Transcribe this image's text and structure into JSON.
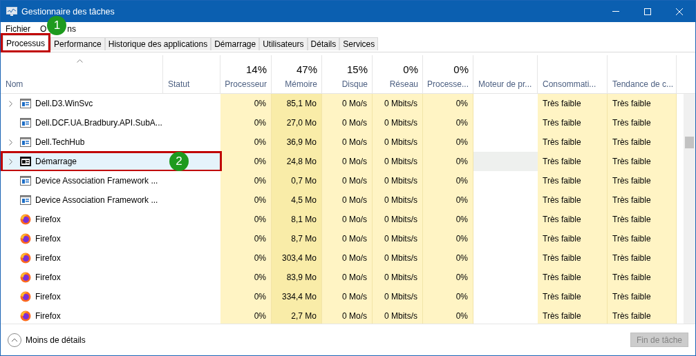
{
  "window": {
    "title": "Gestionnaire des tâches"
  },
  "menu": [
    {
      "label": "Fichier"
    },
    {
      "label": "O",
      "rest": "ns"
    }
  ],
  "tabs": [
    {
      "label": "Processus",
      "selected": true
    },
    {
      "label": "Performance",
      "selected": false
    },
    {
      "label": "Historique des applications",
      "selected": false
    },
    {
      "label": "Démarrage",
      "selected": false
    },
    {
      "label": "Utilisateurs",
      "selected": false
    },
    {
      "label": "Détails",
      "selected": false
    },
    {
      "label": "Services",
      "selected": false
    }
  ],
  "columns": [
    {
      "label": "Nom"
    },
    {
      "label": "Statut"
    },
    {
      "label": "Processeur",
      "total": "14%"
    },
    {
      "label": "Mémoire",
      "total": "47%"
    },
    {
      "label": "Disque",
      "total": "15%"
    },
    {
      "label": "Réseau",
      "total": "0%"
    },
    {
      "label": "Processe...",
      "total": "0%"
    },
    {
      "label": "Moteur de pr..."
    },
    {
      "label": "Consommati..."
    },
    {
      "label": "Tendance de c..."
    }
  ],
  "rows": [
    {
      "kind": "app",
      "expandable": true,
      "selected": false,
      "name": "Dell.D3.WinSvc",
      "cpu": "0%",
      "memory": "85,1 Mo",
      "disk": "0 Mo/s",
      "network": "0 Mbits/s",
      "gpu": "0%",
      "power": "Très faible",
      "trend": "Très faible"
    },
    {
      "kind": "app",
      "expandable": false,
      "selected": false,
      "name": "Dell.DCF.UA.Bradbury.API.SubA...",
      "cpu": "0%",
      "memory": "27,0 Mo",
      "disk": "0 Mo/s",
      "network": "0 Mbits/s",
      "gpu": "0%",
      "power": "Très faible",
      "trend": "Très faible"
    },
    {
      "kind": "app",
      "expandable": true,
      "selected": false,
      "name": "Dell.TechHub",
      "cpu": "0%",
      "memory": "36,9 Mo",
      "disk": "0 Mo/s",
      "network": "0 Mbits/s",
      "gpu": "0%",
      "power": "Très faible",
      "trend": "Très faible"
    },
    {
      "kind": "startup",
      "expandable": true,
      "selected": true,
      "name": "Démarrage",
      "cpu": "0%",
      "memory": "24,8 Mo",
      "disk": "0 Mo/s",
      "network": "0 Mbits/s",
      "gpu": "0%",
      "power": "Très faible",
      "trend": "Très faible"
    },
    {
      "kind": "app",
      "expandable": false,
      "selected": false,
      "name": "Device Association Framework ...",
      "cpu": "0%",
      "memory": "0,7 Mo",
      "disk": "0 Mo/s",
      "network": "0 Mbits/s",
      "gpu": "0%",
      "power": "Très faible",
      "trend": "Très faible"
    },
    {
      "kind": "app",
      "expandable": false,
      "selected": false,
      "name": "Device Association Framework ...",
      "cpu": "0%",
      "memory": "4,5 Mo",
      "disk": "0 Mo/s",
      "network": "0 Mbits/s",
      "gpu": "0%",
      "power": "Très faible",
      "trend": "Très faible"
    },
    {
      "kind": "firefox",
      "expandable": false,
      "selected": false,
      "name": "Firefox",
      "cpu": "0%",
      "memory": "8,1 Mo",
      "disk": "0 Mo/s",
      "network": "0 Mbits/s",
      "gpu": "0%",
      "power": "Très faible",
      "trend": "Très faible"
    },
    {
      "kind": "firefox",
      "expandable": false,
      "selected": false,
      "name": "Firefox",
      "cpu": "0%",
      "memory": "8,7 Mo",
      "disk": "0 Mo/s",
      "network": "0 Mbits/s",
      "gpu": "0%",
      "power": "Très faible",
      "trend": "Très faible"
    },
    {
      "kind": "firefox",
      "expandable": false,
      "selected": false,
      "name": "Firefox",
      "cpu": "0%",
      "memory": "303,4 Mo",
      "disk": "0 Mo/s",
      "network": "0 Mbits/s",
      "gpu": "0%",
      "power": "Très faible",
      "trend": "Très faible"
    },
    {
      "kind": "firefox",
      "expandable": false,
      "selected": false,
      "name": "Firefox",
      "cpu": "0%",
      "memory": "83,9 Mo",
      "disk": "0 Mo/s",
      "network": "0 Mbits/s",
      "gpu": "0%",
      "power": "Très faible",
      "trend": "Très faible"
    },
    {
      "kind": "firefox",
      "expandable": false,
      "selected": false,
      "name": "Firefox",
      "cpu": "0%",
      "memory": "334,4 Mo",
      "disk": "0 Mo/s",
      "network": "0 Mbits/s",
      "gpu": "0%",
      "power": "Très faible",
      "trend": "Très faible"
    },
    {
      "kind": "firefox",
      "expandable": false,
      "selected": false,
      "name": "Firefox",
      "cpu": "0%",
      "memory": "2,7 Mo",
      "disk": "0 Mo/s",
      "network": "0 Mbits/s",
      "gpu": "0%",
      "power": "Très faible",
      "trend": "Très faible"
    }
  ],
  "footer": {
    "details": "Moins de détails",
    "end_task": "Fin de tâche",
    "end_task_disabled": true
  },
  "annotations": [
    "1",
    "2"
  ]
}
